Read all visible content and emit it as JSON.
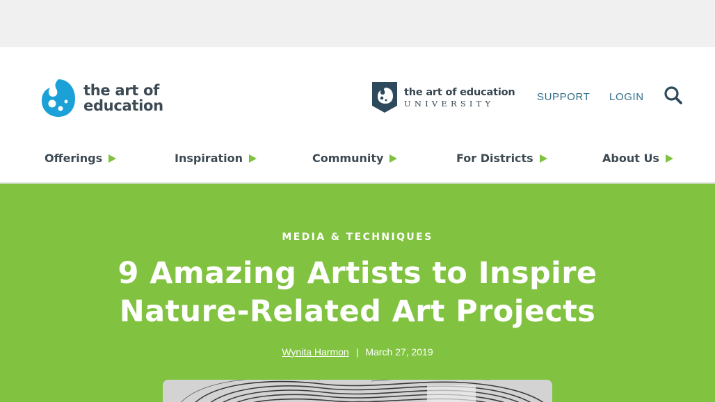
{
  "header": {
    "logo": {
      "line1": "the art of",
      "line2": "education"
    },
    "university_logo": {
      "line1": "the art of education",
      "line2": "UNIVERSITY"
    },
    "links": {
      "support": "SUPPORT",
      "login": "LOGIN"
    },
    "search_icon": "search-icon"
  },
  "nav": {
    "items": [
      {
        "label": "Offerings"
      },
      {
        "label": "Inspiration"
      },
      {
        "label": "Community"
      },
      {
        "label": "For Districts"
      },
      {
        "label": "About Us"
      }
    ]
  },
  "article": {
    "category": "MEDIA & TECHNIQUES",
    "title": "9 Amazing Artists to Inspire Nature-Related Art Projects",
    "author": "Wynita Harmon",
    "separator": "|",
    "date": "March 27, 2019"
  },
  "colors": {
    "brand_green": "#81c341",
    "brand_blue": "#1ba1d8",
    "navy": "#2d4a5d",
    "text_dark": "#3d4a53",
    "link_blue": "#2f6c89"
  }
}
